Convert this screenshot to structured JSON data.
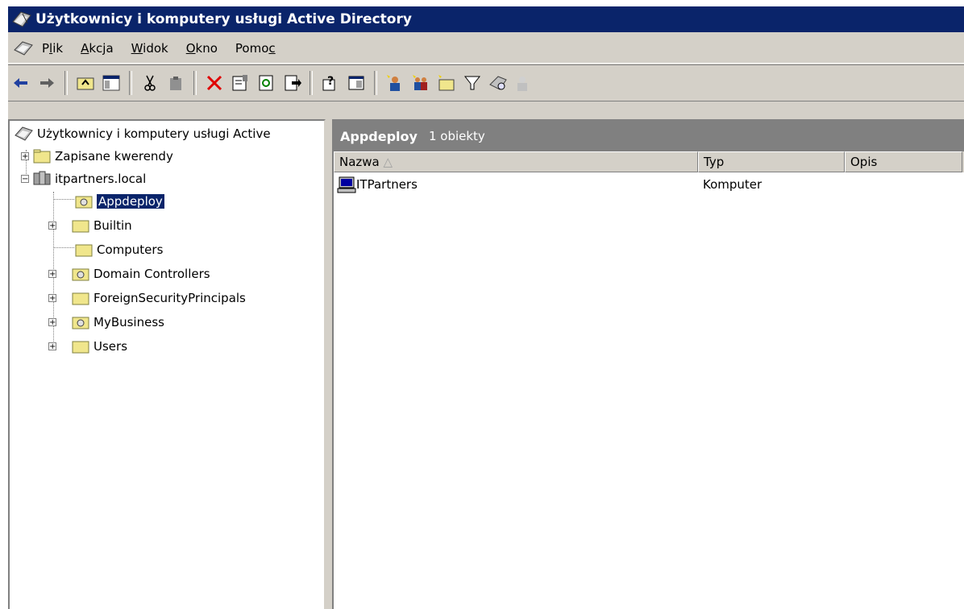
{
  "window": {
    "title": "Użytkownicy i komputery usługi Active Directory"
  },
  "menu": {
    "items": [
      {
        "label_pre": "P",
        "label_ul": "l",
        "label_post": "ik"
      },
      {
        "label_pre": "",
        "label_ul": "A",
        "label_post": "kcja"
      },
      {
        "label_pre": "",
        "label_ul": "W",
        "label_post": "idok"
      },
      {
        "label_pre": "",
        "label_ul": "O",
        "label_post": "kno"
      },
      {
        "label_pre": "Pomo",
        "label_ul": "c",
        "label_post": ""
      }
    ]
  },
  "toolbar": {
    "icons": [
      "back-arrow-icon",
      "forward-arrow-icon",
      "up-folder-icon",
      "show-hide-tree-icon",
      "cut-icon",
      "paste-icon",
      "delete-icon",
      "properties-icon",
      "refresh-icon",
      "export-list-icon",
      "help-icon",
      "console-tree-icon",
      "new-user-icon",
      "new-group-icon",
      "new-ou-icon",
      "filter-icon",
      "find-icon",
      "add-to-group-icon"
    ]
  },
  "tree": {
    "root": "Użytkownicy i komputery usługi Active",
    "saved_queries": "Zapisane kwerendy",
    "domain": "itpartners.local",
    "children": [
      "Appdeploy",
      "Builtin",
      "Computers",
      "Domain Controllers",
      "ForeignSecurityPrincipals",
      "MyBusiness",
      "Users"
    ]
  },
  "right": {
    "title": "Appdeploy",
    "count": "1 obiekty",
    "columns": {
      "name": "Nazwa",
      "type": "Typ",
      "desc": "Opis"
    },
    "rows": [
      {
        "name": "ITPartners",
        "type": "Komputer"
      }
    ]
  }
}
